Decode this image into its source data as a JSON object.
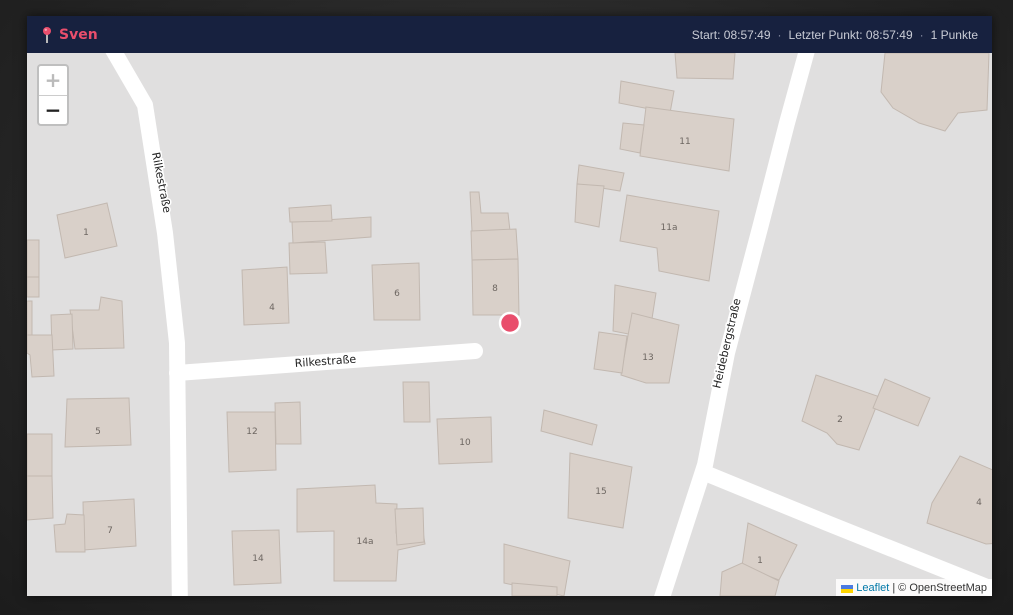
{
  "header": {
    "title": "Sven",
    "start_label": "Start:",
    "start_time": "08:57:49",
    "last_label": "Letzter Punkt:",
    "last_time": "08:57:49",
    "points": "1 Punkte",
    "separator": "·"
  },
  "zoom": {
    "in": "+",
    "out": "−"
  },
  "map": {
    "streets": {
      "rilke_vertical": "Rilkestraße",
      "rilke_horizontal": "Rilkestraße",
      "heidebergstrasse": "Heidebergstraße"
    },
    "house_numbers": [
      "1",
      "4",
      "6",
      "8",
      "11",
      "11a",
      "13",
      "5",
      "12",
      "10",
      "2",
      "15",
      "7",
      "14",
      "14a",
      "4",
      "1"
    ],
    "marker_color": "#e94e6c"
  },
  "attribution": {
    "leaflet": "Leaflet",
    "sep": "|",
    "osm": "© OpenStreetMap"
  },
  "colors": {
    "header_bg": "#17213f",
    "accent": "#e94e6c",
    "map_bg": "#e0dfdf",
    "building": "#d9d0c9",
    "road": "#ffffff"
  }
}
